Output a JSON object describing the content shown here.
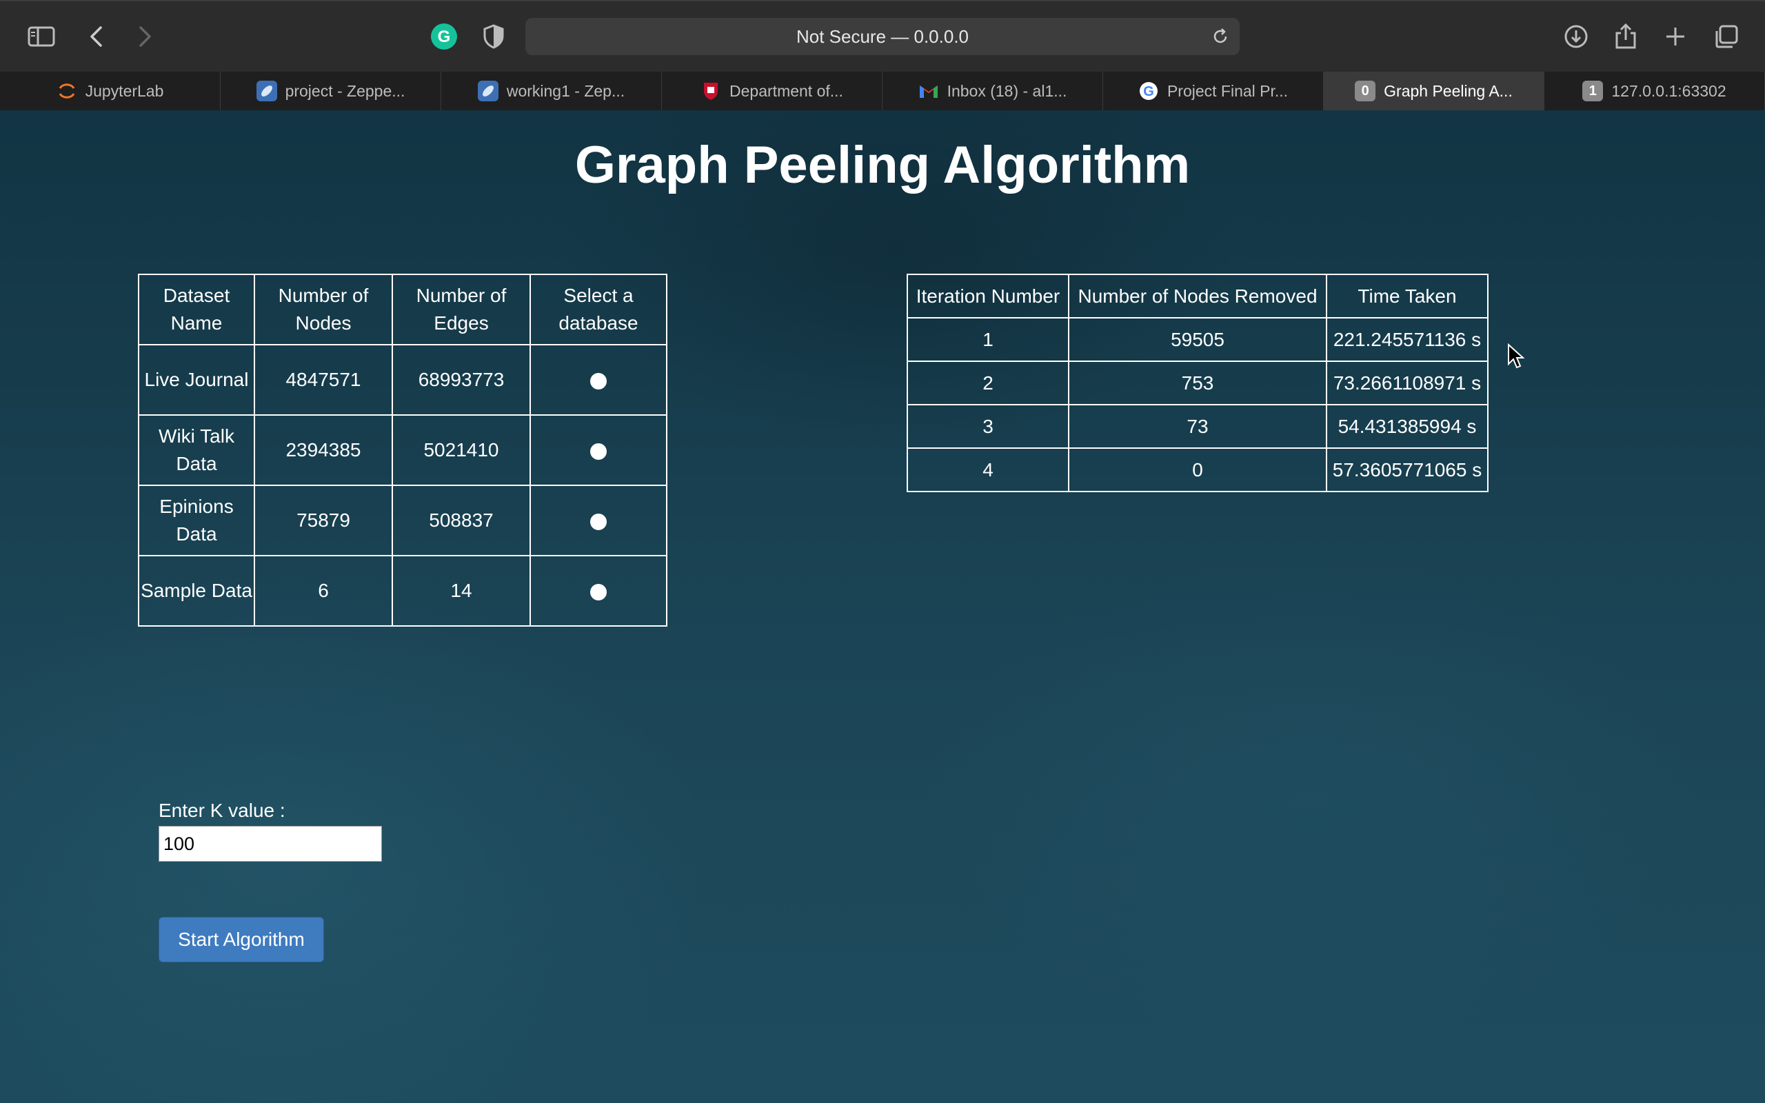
{
  "browser": {
    "url_text": "Not Secure — 0.0.0.0",
    "tabs": [
      {
        "label": "JupyterLab",
        "icon": "jupyter-icon"
      },
      {
        "label": "project - Zeppe...",
        "icon": "zeppelin-icon"
      },
      {
        "label": "working1 - Zep...",
        "icon": "zeppelin-icon"
      },
      {
        "label": "Department of...",
        "icon": "university-shield-icon"
      },
      {
        "label": "Inbox (18) - al1...",
        "icon": "gmail-icon"
      },
      {
        "label": "Project Final Pr...",
        "icon": "google-icon"
      },
      {
        "label": "Graph Peeling A...",
        "icon": "tab-number-badge",
        "badge": "0",
        "active": true
      },
      {
        "label": "127.0.0.1:63302",
        "icon": "tab-number-badge",
        "badge": "1"
      }
    ]
  },
  "page": {
    "title": "Graph Peeling Algorithm",
    "datasets": {
      "headers": [
        "Dataset Name",
        "Number of Nodes",
        "Number of Edges",
        "Select a database"
      ],
      "rows": [
        {
          "name": "Live Journal",
          "nodes": "4847571",
          "edges": "68993773"
        },
        {
          "name": "Wiki Talk Data",
          "nodes": "2394385",
          "edges": "5021410"
        },
        {
          "name": "Epinions Data",
          "nodes": "75879",
          "edges": "508837"
        },
        {
          "name": "Sample Data",
          "nodes": "6",
          "edges": "14"
        }
      ]
    },
    "iterations": {
      "headers": [
        "Iteration Number",
        "Number of Nodes Removed",
        "Time Taken"
      ],
      "rows": [
        {
          "iteration": "1",
          "removed": "59505",
          "time": "221.245571136 s"
        },
        {
          "iteration": "2",
          "removed": "753",
          "time": "73.2661108971 s"
        },
        {
          "iteration": "3",
          "removed": "73",
          "time": "54.431385994 s"
        },
        {
          "iteration": "4",
          "removed": "0",
          "time": "57.3605771065 s"
        }
      ]
    },
    "k_label": "Enter K value :",
    "k_value": "100",
    "start_button": "Start Algorithm"
  }
}
